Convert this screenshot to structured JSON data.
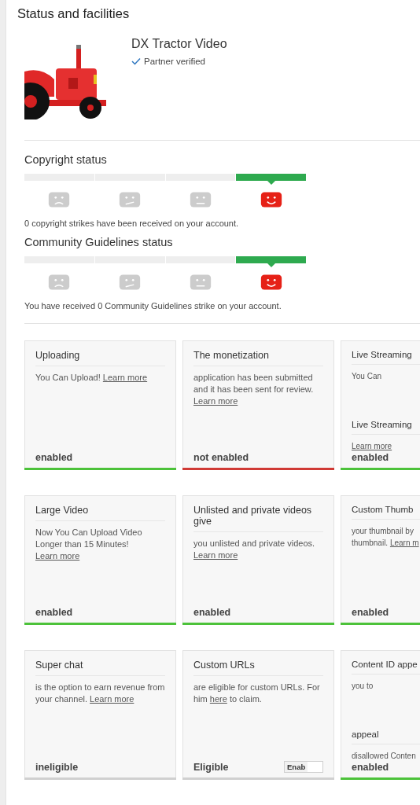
{
  "title": "Status and facilities",
  "channel": {
    "name": "DX Tractor Video",
    "badge": "Partner verified"
  },
  "meters": [
    {
      "heading": "Copyright status",
      "note": "0 copyright strikes have been received on your account.",
      "segments": [
        {
          "selected": false
        },
        {
          "selected": false
        },
        {
          "selected": false
        },
        {
          "selected": true
        }
      ]
    },
    {
      "heading": "Community Guidelines status",
      "note": "You have received 0 Community Guidelines strike on your account.",
      "segments": [
        {
          "selected": false
        },
        {
          "selected": false
        },
        {
          "selected": false
        },
        {
          "selected": true
        }
      ]
    }
  ],
  "cards": [
    {
      "sections": [
        {
          "title": "Uploading",
          "parts": [
            {
              "kind": "text",
              "text": "You Can Upload!"
            },
            {
              "kind": "link",
              "text": "Learn more"
            }
          ]
        }
      ],
      "status": "enabled",
      "color": "#4cc23a"
    },
    {
      "sections": [
        {
          "title": "The monetization",
          "parts": [
            {
              "kind": "text",
              "text": "application has been submitted and it has been sent for review."
            },
            {
              "kind": "link",
              "text": "Learn more"
            }
          ]
        }
      ],
      "status": "not enabled",
      "color": "#d03a35"
    },
    {
      "sections": [
        {
          "title": "Live Streaming",
          "parts": [
            {
              "kind": "text",
              "text": "You Can"
            }
          ]
        },
        {
          "title": "Live Streaming",
          "parts": [
            {
              "kind": "link",
              "text": "Learn more"
            }
          ]
        }
      ],
      "status": "enabled",
      "color": "#4cc23a"
    },
    {
      "sections": [
        {
          "title": "Large Video",
          "parts": [
            {
              "kind": "text",
              "text": "Now You Can Upload Video Longer than 15 Minutes!"
            },
            {
              "kind": "link",
              "text": "Learn more"
            }
          ]
        }
      ],
      "status": "enabled",
      "color": "#4cc23a"
    },
    {
      "sections": [
        {
          "title": "Unlisted and private videos give",
          "parts": [
            {
              "kind": "text",
              "text": "you unlisted and private videos."
            },
            {
              "kind": "link",
              "text": "Learn more"
            }
          ]
        }
      ],
      "status": "enabled",
      "color": "#4cc23a"
    },
    {
      "sections": [
        {
          "title": "Custom Thumb",
          "parts": [
            {
              "kind": "text",
              "text": "your thumbnail by"
            },
            {
              "kind": "break"
            },
            {
              "kind": "text",
              "text": "thumbnail."
            },
            {
              "kind": "link",
              "text": "Learn m"
            }
          ]
        }
      ],
      "status": "enabled",
      "color": "#4cc23a"
    },
    {
      "sections": [
        {
          "title": "Super chat",
          "parts": [
            {
              "kind": "text",
              "text": "is the option to earn revenue from your channel."
            },
            {
              "kind": "link",
              "text": "Learn more"
            }
          ]
        }
      ],
      "status": "ineligible",
      "color": "#d0d0d0"
    },
    {
      "sections": [
        {
          "title": "Custom URLs",
          "parts": [
            {
              "kind": "text",
              "text": "are eligible for custom URLs. For him"
            },
            {
              "kind": "link",
              "text": "here"
            },
            {
              "kind": "text",
              "text": "to claim."
            }
          ]
        }
      ],
      "status": "Eligible",
      "color": "#d0d0d0",
      "toggle": {
        "label": "Enab",
        "on": false
      }
    },
    {
      "sections": [
        {
          "title": "Content ID appe",
          "parts": [
            {
              "kind": "text",
              "text": "you to"
            }
          ]
        },
        {
          "title": "appeal",
          "parts": [
            {
              "kind": "text",
              "text": "disallowed Conten"
            }
          ]
        }
      ],
      "status": "enabled",
      "color": "#4cc23a"
    }
  ]
}
